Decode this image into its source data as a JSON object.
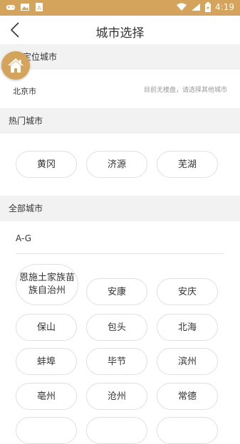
{
  "status_bar": {
    "time": "4:19",
    "left_icons": [
      "gamepad-icon",
      "image-icon",
      "font-icon"
    ],
    "right_icons": [
      "wifi-icon",
      "signal-icon",
      "battery-icon"
    ]
  },
  "nav": {
    "title": "城市选择"
  },
  "sections": {
    "located": {
      "header": "定位城市",
      "city": "北京市",
      "hint": "目前无楼盘，请选择其他城市"
    },
    "hot": {
      "header": "热门城市",
      "cities": [
        "黄冈",
        "济源",
        "芜湖"
      ]
    },
    "all": {
      "header": "全部城市",
      "letter_group": "A-G",
      "cities": [
        "恩施土家族苗族自治州",
        "安康",
        "安庆",
        "保山",
        "包头",
        "北海",
        "蚌埠",
        "毕节",
        "滨州",
        "亳州",
        "沧州",
        "常德"
      ]
    }
  },
  "colors": {
    "accent": "#d5a45c",
    "section_bg": "#f2f2f2",
    "border": "#e0e0e0"
  }
}
